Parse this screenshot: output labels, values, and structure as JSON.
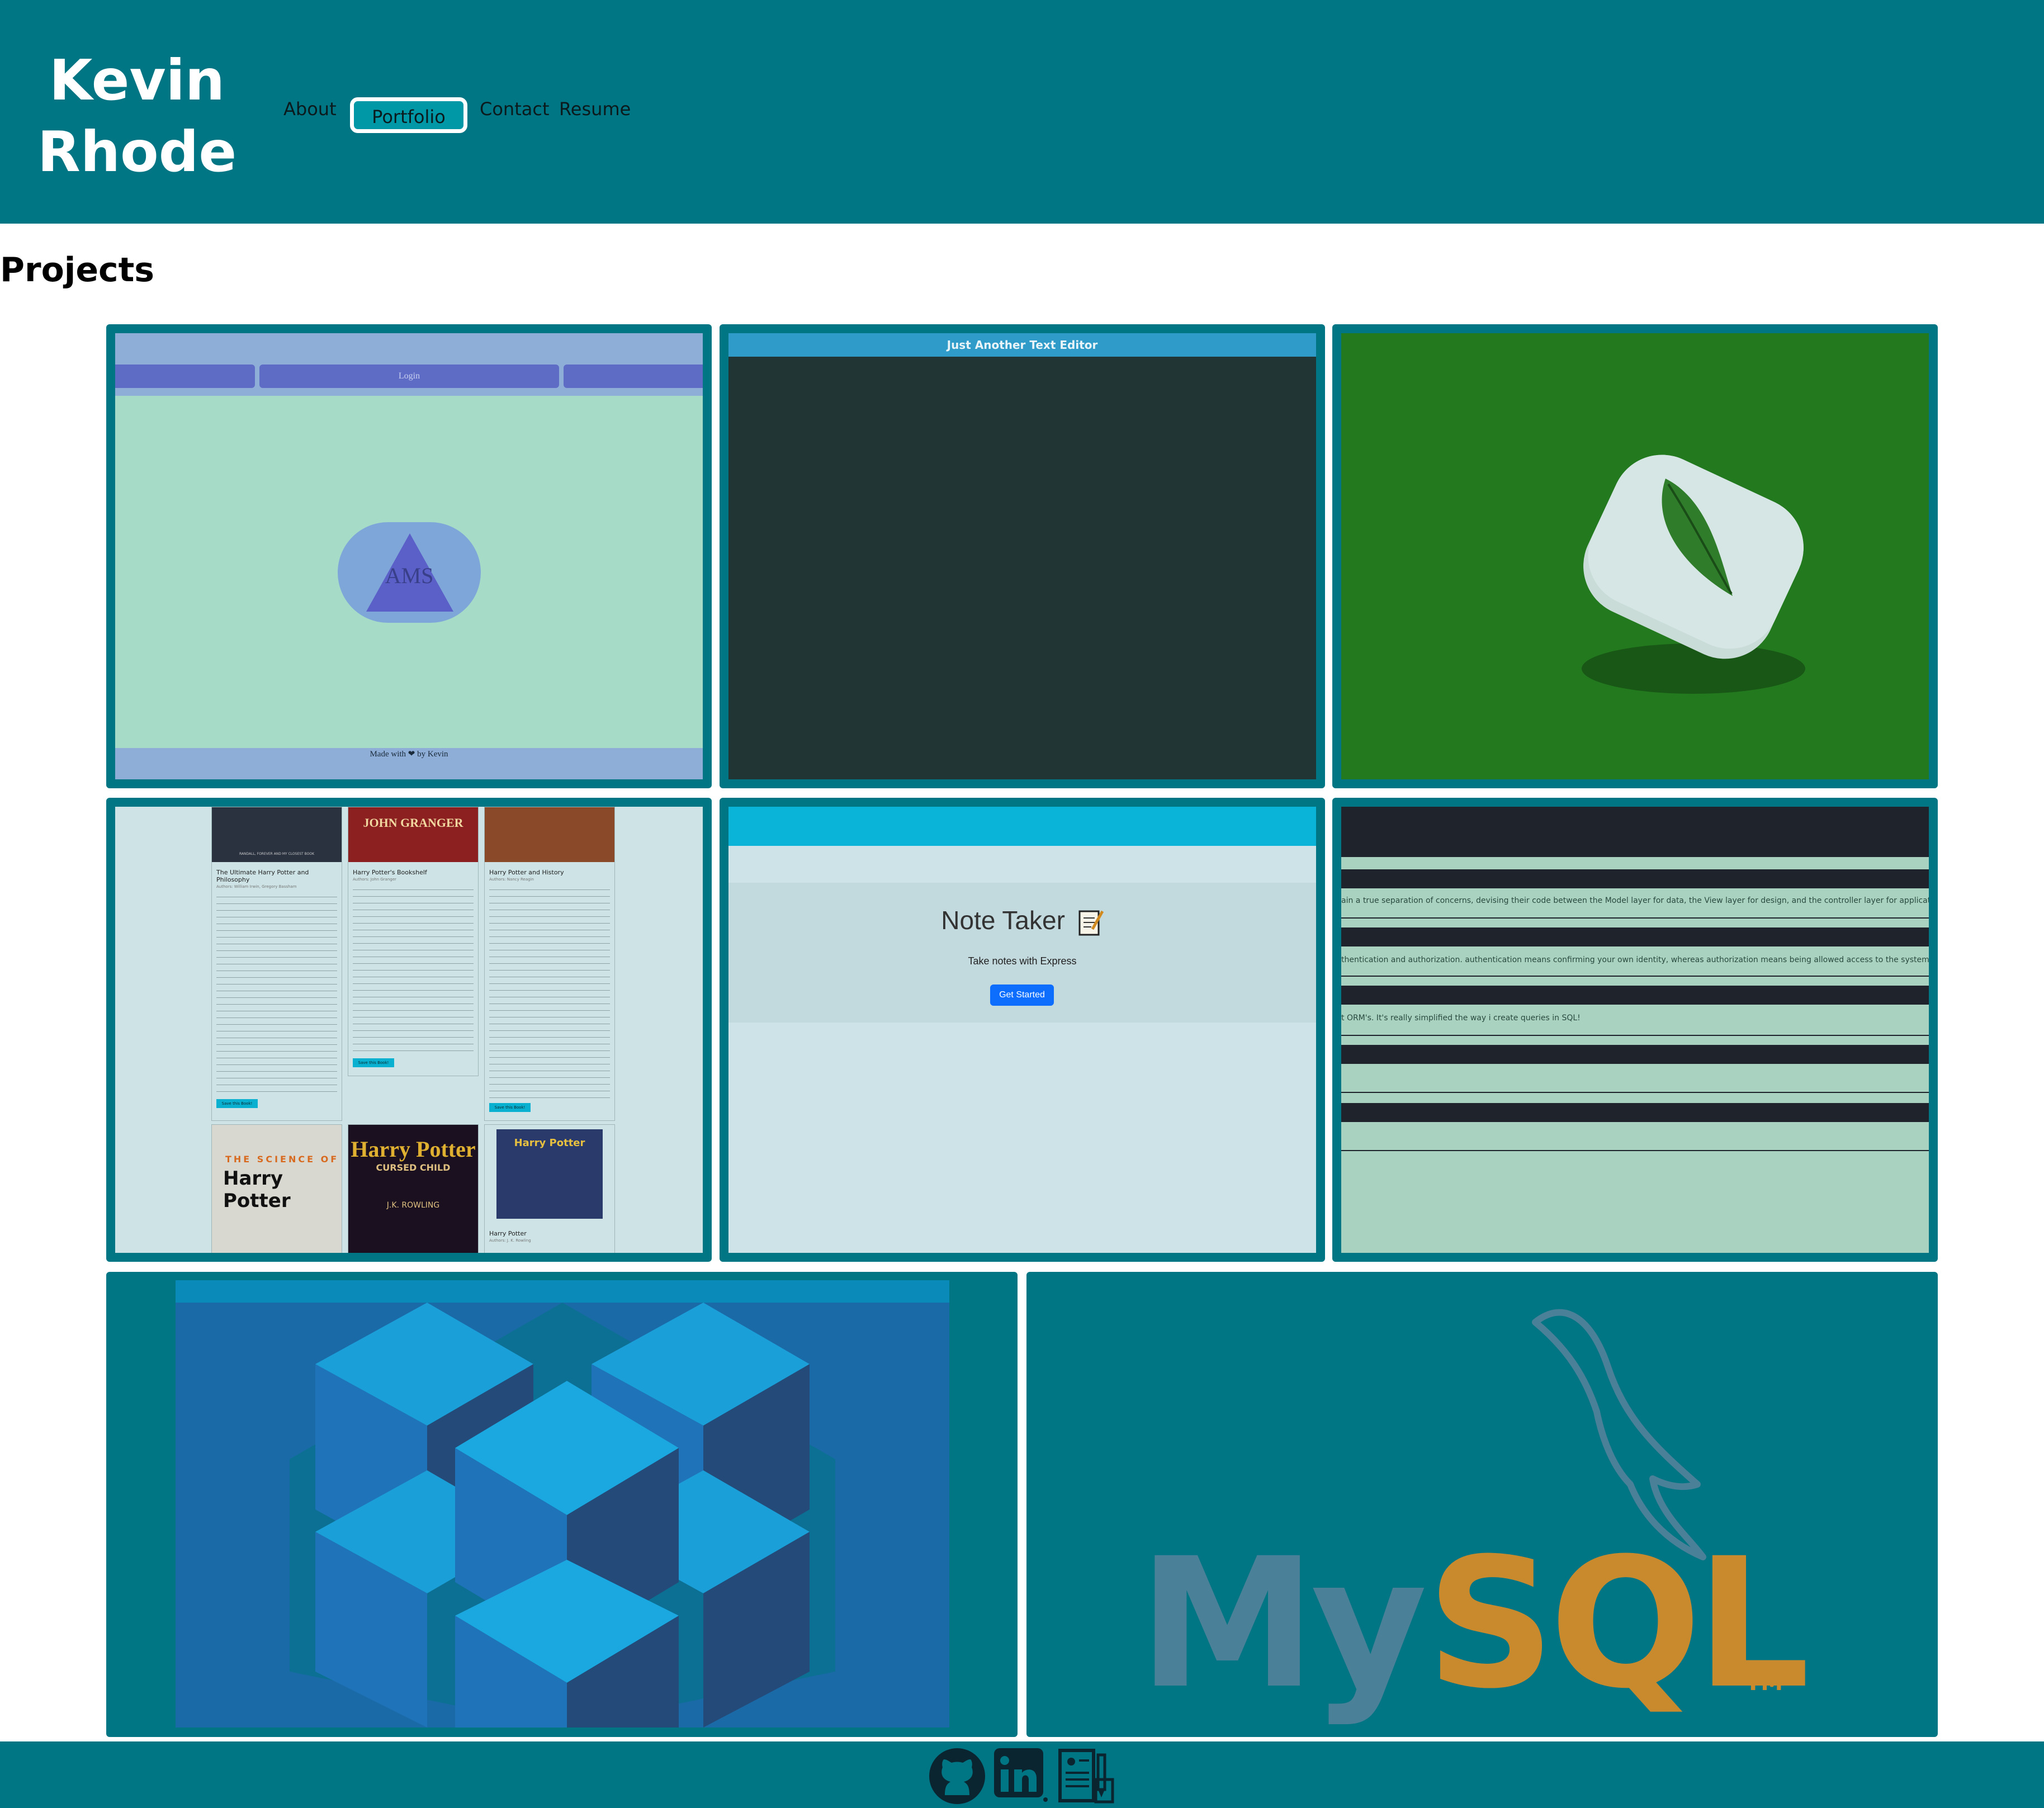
{
  "header": {
    "name_line1": "Kevin",
    "name_line2": "Rhode",
    "nav": {
      "about": "About",
      "portfolio": "Portfolio",
      "contact": "Contact",
      "resume": "Resume"
    }
  },
  "projects": {
    "title": "Projects",
    "ams": {
      "login": "Login",
      "logo": "AMS",
      "footer_text": "Made with ❤ by Kevin"
    },
    "text_editor": {
      "title": "Just Another Text Editor"
    },
    "book_search": {
      "books": [
        {
          "title": "The Ultimate Harry Potter and Philosophy",
          "authors": "Authors: William Irwin, Gregory Bassham",
          "button": "Save this Book!"
        },
        {
          "title": "Harry Potter's Bookshelf",
          "authors": "Authors: John Granger",
          "button": "Save this Book!"
        },
        {
          "title": "Harry Potter and History",
          "authors": "Authors: Nancy Reagin",
          "button": "Save this Book!"
        },
        {
          "title": "Harry Potter",
          "authors": "Authors: J. K. Rowling"
        }
      ],
      "cover1_text": "RANDALL, FOREVER AND MY CLOSEST BOOK",
      "cover2_text": "JOHN GRANGER",
      "cover4_line1": "THE SCIENCE OF",
      "cover4_line2": "Harry Potter",
      "cover5_line1": "Harry Potter",
      "cover5_line2": "CURSED CHILD",
      "cover5_author": "J.K. ROWLING",
      "cover6_text": "Harry Potter"
    },
    "note_taker": {
      "title": "Note Taker",
      "subtitle": "Take notes with Express",
      "button": "Get Started"
    },
    "tech_blog": {
      "lines": [
        "ain a true separation of concerns, devising their code between the Model layer for data, the View layer for design, and the controller layer for application logic",
        "thentication and authorization. authentication means confirming your own identity, whereas authorization means being allowed access to the system.",
        "t ORM's. It's really simplified the way i create queries in SQL!"
      ]
    },
    "mysql": {
      "my": "My",
      "sql": "SQL",
      "tm": "TM"
    }
  },
  "footer": {
    "icons": [
      "github-icon",
      "linkedin-icon",
      "resume-icon"
    ],
    "linkedin_text": "in"
  },
  "colors": {
    "brand": "#007584",
    "mysql_blue": "#4a8098",
    "mysql_orange": "#c98a2e"
  }
}
